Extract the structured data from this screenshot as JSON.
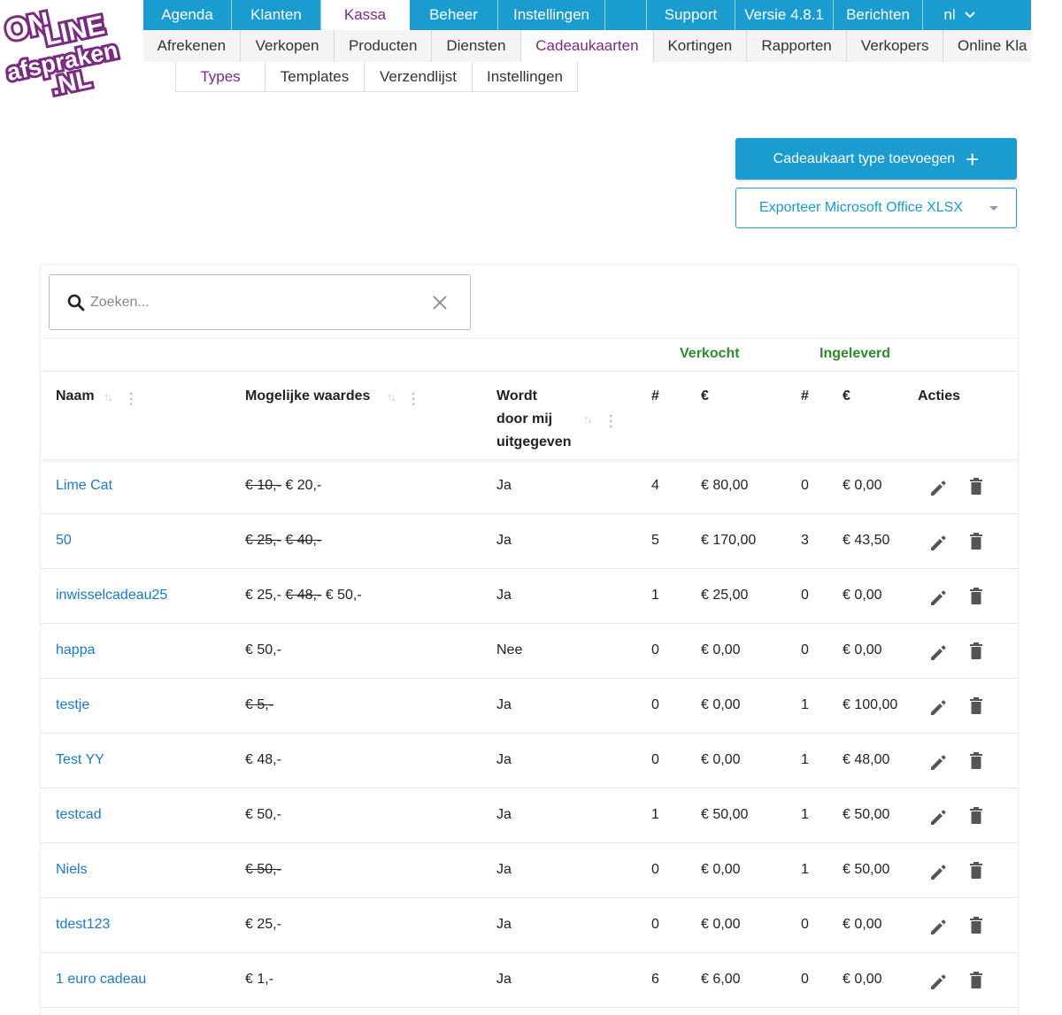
{
  "logo": {
    "alt_text": "ONLINE afspraken .NL"
  },
  "topnav": [
    {
      "label": "Agenda",
      "active": false
    },
    {
      "label": "Klanten",
      "active": false
    },
    {
      "label": "Kassa",
      "active": true
    },
    {
      "label": "Beheer",
      "active": false
    },
    {
      "label": "Instellingen",
      "active": false
    },
    {
      "label": "Support",
      "active": false
    },
    {
      "label": "Versie 4.8.1",
      "active": false
    },
    {
      "label": "Berichten",
      "active": false
    },
    {
      "label": "nl",
      "active": false
    }
  ],
  "subnav": [
    {
      "label": "Afrekenen"
    },
    {
      "label": "Verkopen"
    },
    {
      "label": "Producten"
    },
    {
      "label": "Diensten"
    },
    {
      "label": "Cadeaukaarten",
      "active": true
    },
    {
      "label": "Kortingen"
    },
    {
      "label": "Rapporten"
    },
    {
      "label": "Verkopers"
    },
    {
      "label": "Online Kla"
    }
  ],
  "thirdnav": [
    {
      "label": "Types",
      "active": true
    },
    {
      "label": "Templates"
    },
    {
      "label": "Verzendlijst"
    },
    {
      "label": "Instellingen"
    }
  ],
  "actions": {
    "add_label": "Cadeaukaart type toevoegen",
    "add_icon": "+",
    "export_label": "Exporteer Microsoft Office XLSX"
  },
  "search": {
    "placeholder": "Zoeken...",
    "value": ""
  },
  "groups": {
    "sold": "Verkocht",
    "redeemed": "Ingeleverd"
  },
  "columns": {
    "name": "Naam",
    "values": "Mogelijke waardes",
    "issued_line1": "Wordt",
    "issued_line2": "door mij",
    "issued_line3": "uitgegeven",
    "sold_count": "#",
    "sold_amount": "€",
    "redeemed_count": "#",
    "redeemed_amount": "€",
    "actions": "Acties"
  },
  "rows": [
    {
      "name": "Lime Cat",
      "values": [
        {
          "text": "€ 10,-",
          "struck": true
        },
        {
          "text": "€ 20,-",
          "struck": false
        }
      ],
      "issued": "Ja",
      "sold_count": "4",
      "sold_amount": "€ 80,00",
      "redeemed_count": "0",
      "redeemed_amount": "€ 0,00"
    },
    {
      "name": "50",
      "values": [
        {
          "text": "€ 25,-",
          "struck": true
        },
        {
          "text": "€ 40,-",
          "struck": true
        }
      ],
      "issued": "Ja",
      "sold_count": "5",
      "sold_amount": "€ 170,00",
      "redeemed_count": "3",
      "redeemed_amount": "€ 43,50"
    },
    {
      "name": "inwisselcadeau25",
      "values": [
        {
          "text": "€ 25,-",
          "struck": false
        },
        {
          "text": "€ 48,-",
          "struck": true
        },
        {
          "text": "€ 50,-",
          "struck": false
        }
      ],
      "issued": "Ja",
      "sold_count": "1",
      "sold_amount": "€ 25,00",
      "redeemed_count": "0",
      "redeemed_amount": "€ 0,00"
    },
    {
      "name": "happa",
      "values": [
        {
          "text": "€ 50,-",
          "struck": false
        }
      ],
      "issued": "Nee",
      "sold_count": "0",
      "sold_amount": "€ 0,00",
      "redeemed_count": "0",
      "redeemed_amount": "€ 0,00"
    },
    {
      "name": "testje",
      "values": [
        {
          "text": "€ 5,-",
          "struck": true
        }
      ],
      "issued": "Ja",
      "sold_count": "0",
      "sold_amount": "€ 0,00",
      "redeemed_count": "1",
      "redeemed_amount": "€ 100,00"
    },
    {
      "name": "Test YY",
      "values": [
        {
          "text": "€ 48,-",
          "struck": false
        }
      ],
      "issued": "Ja",
      "sold_count": "0",
      "sold_amount": "€ 0,00",
      "redeemed_count": "1",
      "redeemed_amount": "€ 48,00"
    },
    {
      "name": "testcad",
      "values": [
        {
          "text": "€ 50,-",
          "struck": false
        }
      ],
      "issued": "Ja",
      "sold_count": "1",
      "sold_amount": "€ 50,00",
      "redeemed_count": "1",
      "redeemed_amount": "€ 50,00"
    },
    {
      "name": "Niels",
      "values": [
        {
          "text": "€ 50,-",
          "struck": true
        }
      ],
      "issued": "Ja",
      "sold_count": "0",
      "sold_amount": "€ 0,00",
      "redeemed_count": "1",
      "redeemed_amount": "€ 50,00"
    },
    {
      "name": "tdest123",
      "values": [
        {
          "text": "€ 25,-",
          "struck": false
        }
      ],
      "issued": "Ja",
      "sold_count": "0",
      "sold_amount": "€ 0,00",
      "redeemed_count": "0",
      "redeemed_amount": "€ 0,00"
    },
    {
      "name": "1 euro cadeau",
      "values": [
        {
          "text": "€ 1,-",
          "struck": false
        }
      ],
      "issued": "Ja",
      "sold_count": "6",
      "sold_amount": "€ 6,00",
      "redeemed_count": "0",
      "redeemed_amount": "€ 0,00"
    }
  ],
  "colors": {
    "primary": "#1a9cd0",
    "active_text": "#7b2a82",
    "group_green": "#2e8b2e",
    "link": "#1a7ac7"
  }
}
